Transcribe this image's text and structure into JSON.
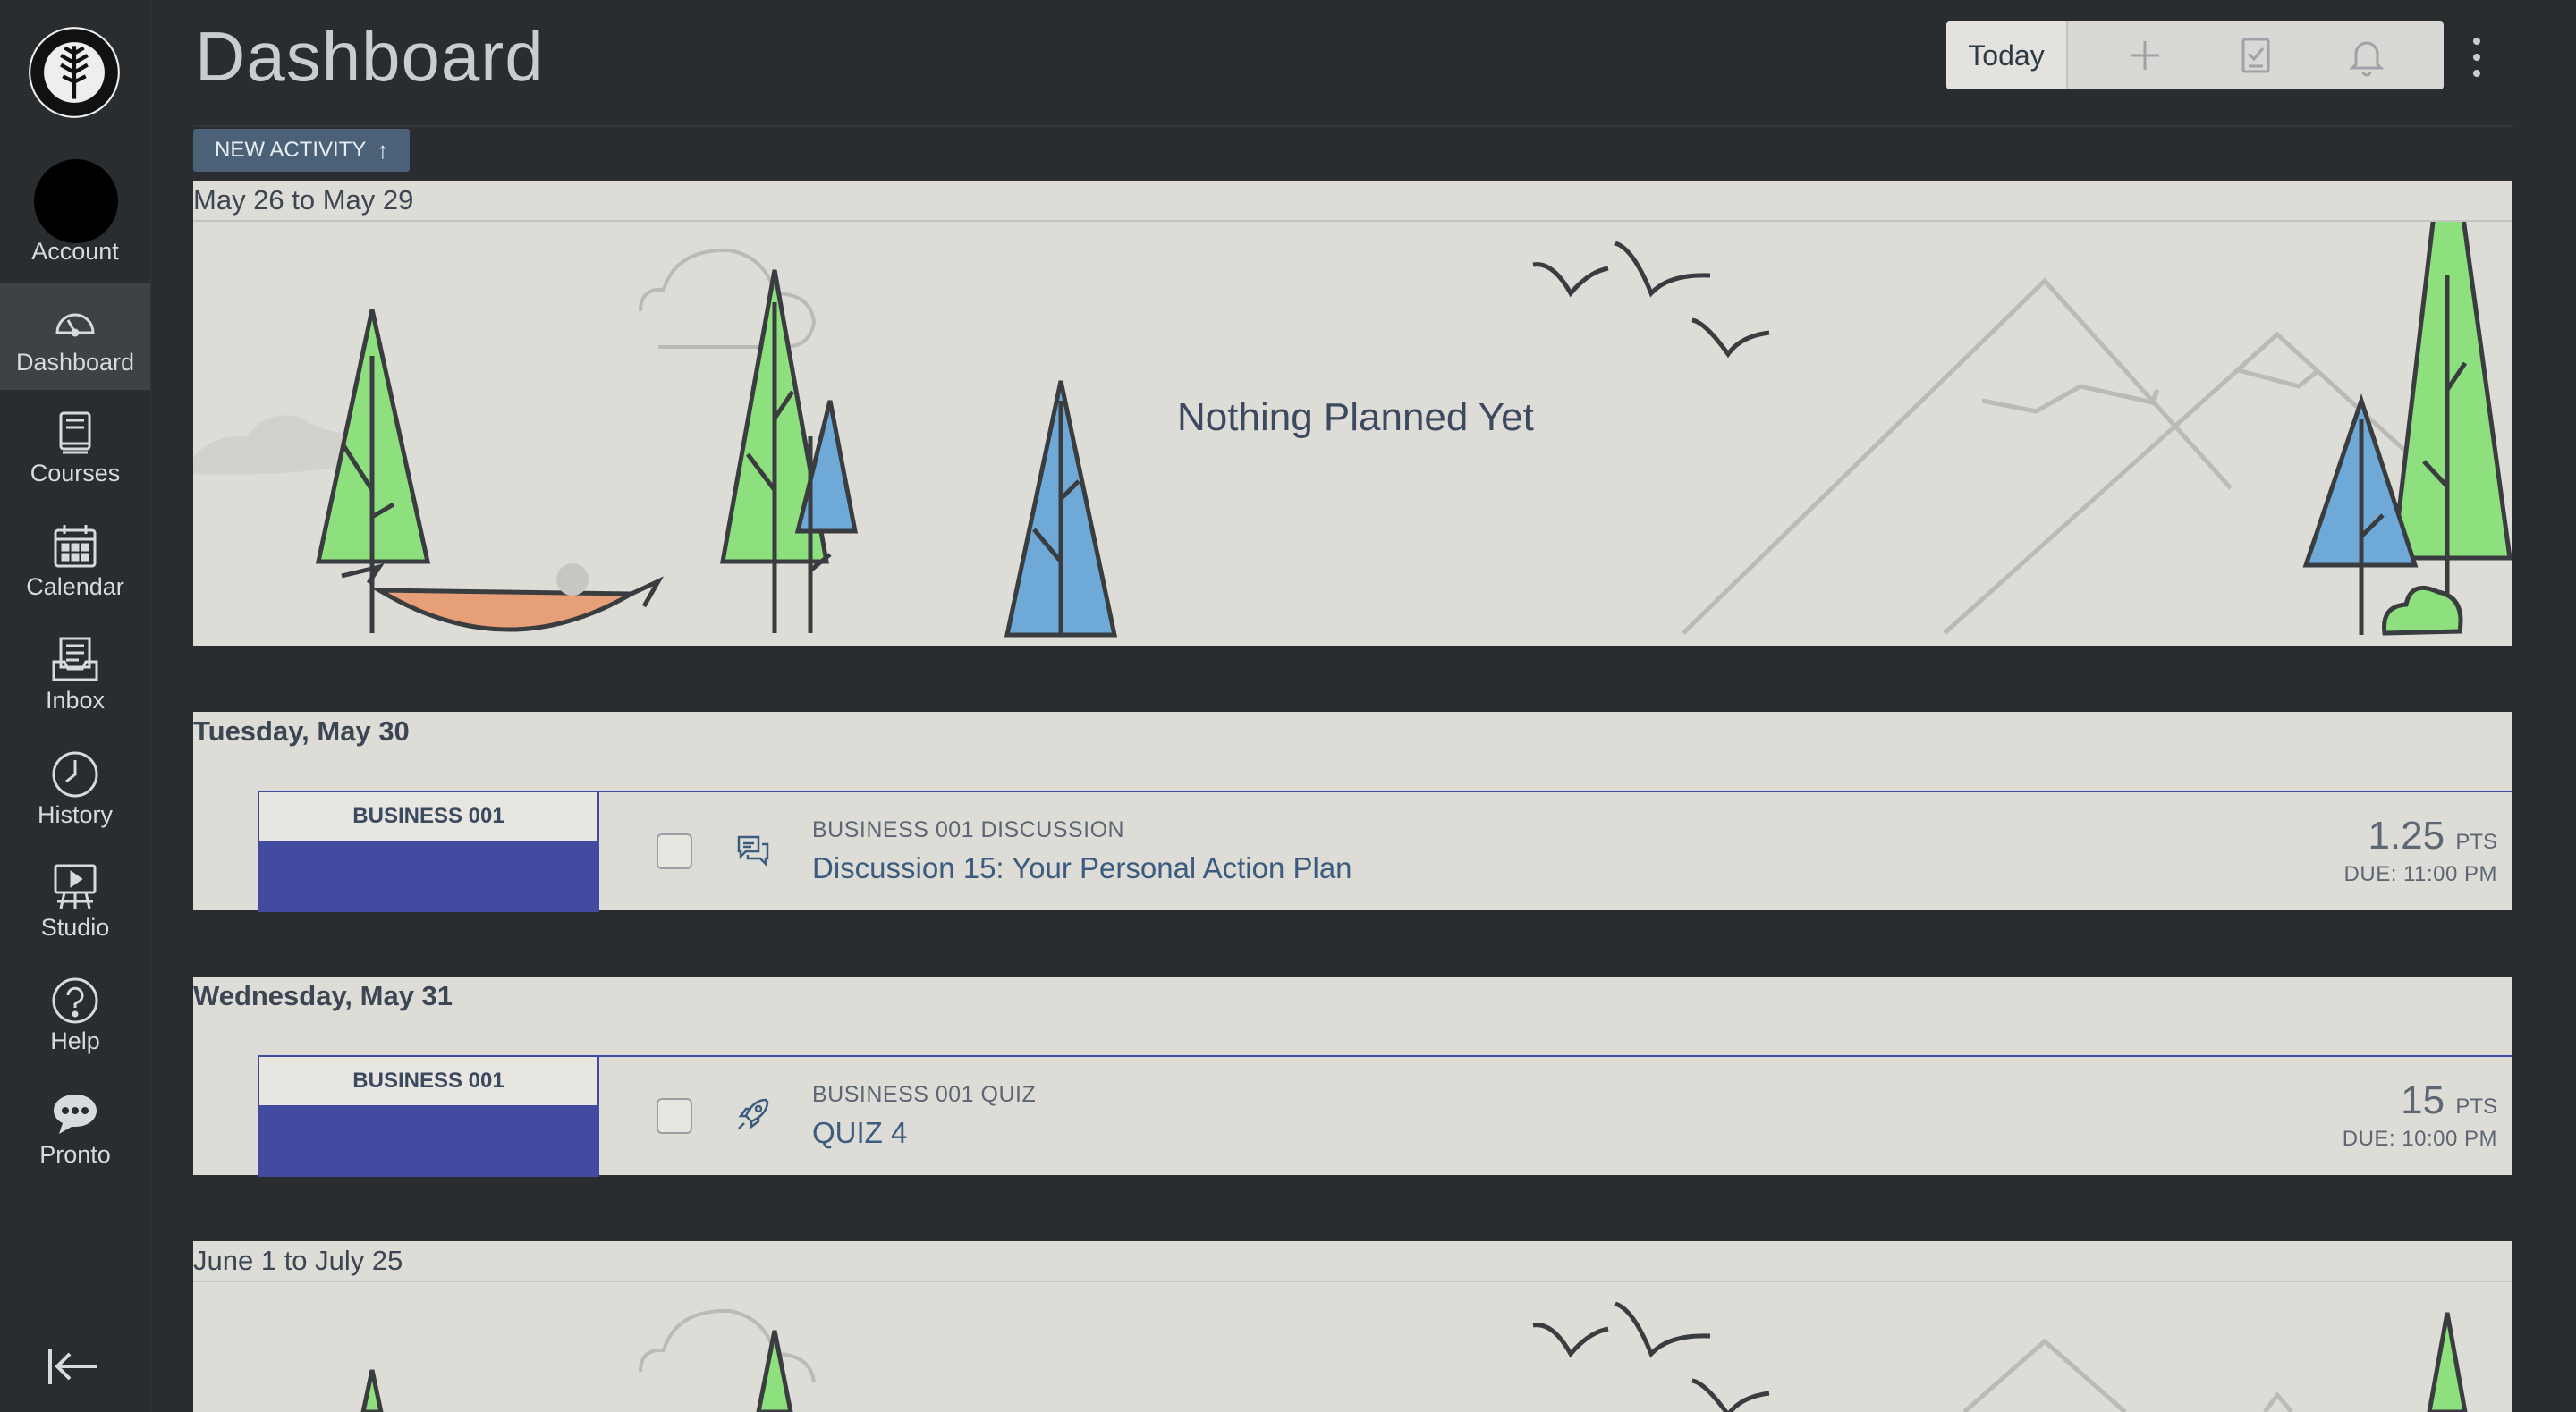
{
  "sidebar": {
    "items": [
      {
        "label": "Account",
        "icon": "avatar"
      },
      {
        "label": "Dashboard",
        "icon": "dashboard-icon"
      },
      {
        "label": "Courses",
        "icon": "courses-icon"
      },
      {
        "label": "Calendar",
        "icon": "calendar-icon"
      },
      {
        "label": "Inbox",
        "icon": "inbox-icon"
      },
      {
        "label": "History",
        "icon": "history-icon"
      },
      {
        "label": "Studio",
        "icon": "studio-icon"
      },
      {
        "label": "Help",
        "icon": "help-icon"
      },
      {
        "label": "Pronto",
        "icon": "pronto-icon"
      }
    ],
    "active": "Dashboard"
  },
  "header": {
    "title": "Dashboard",
    "today_label": "Today"
  },
  "new_activity": {
    "label": "NEW ACTIVITY"
  },
  "sections": {
    "range1": {
      "label": "May 26 to May 29",
      "empty_text": "Nothing Planned Yet"
    },
    "day1": {
      "label": "Tuesday, May 30",
      "item": {
        "course": "BUSINESS 001",
        "type": "BUSINESS 001 DISCUSSION",
        "title": "Discussion 15: Your Personal Action Plan",
        "points": "1.25",
        "points_unit": "PTS",
        "due": "DUE: 11:00 PM"
      }
    },
    "day2": {
      "label": "Wednesday, May 31",
      "item": {
        "course": "BUSINESS 001",
        "type": "BUSINESS 001 QUIZ",
        "title": "QUIZ 4",
        "points": "15",
        "points_unit": "PTS",
        "due": "DUE: 10:00 PM"
      }
    },
    "range2": {
      "label": "June 1 to July 25"
    }
  },
  "colors": {
    "course": "#434ba1",
    "panel": "#dedcd7",
    "background": "#2a2d30"
  }
}
